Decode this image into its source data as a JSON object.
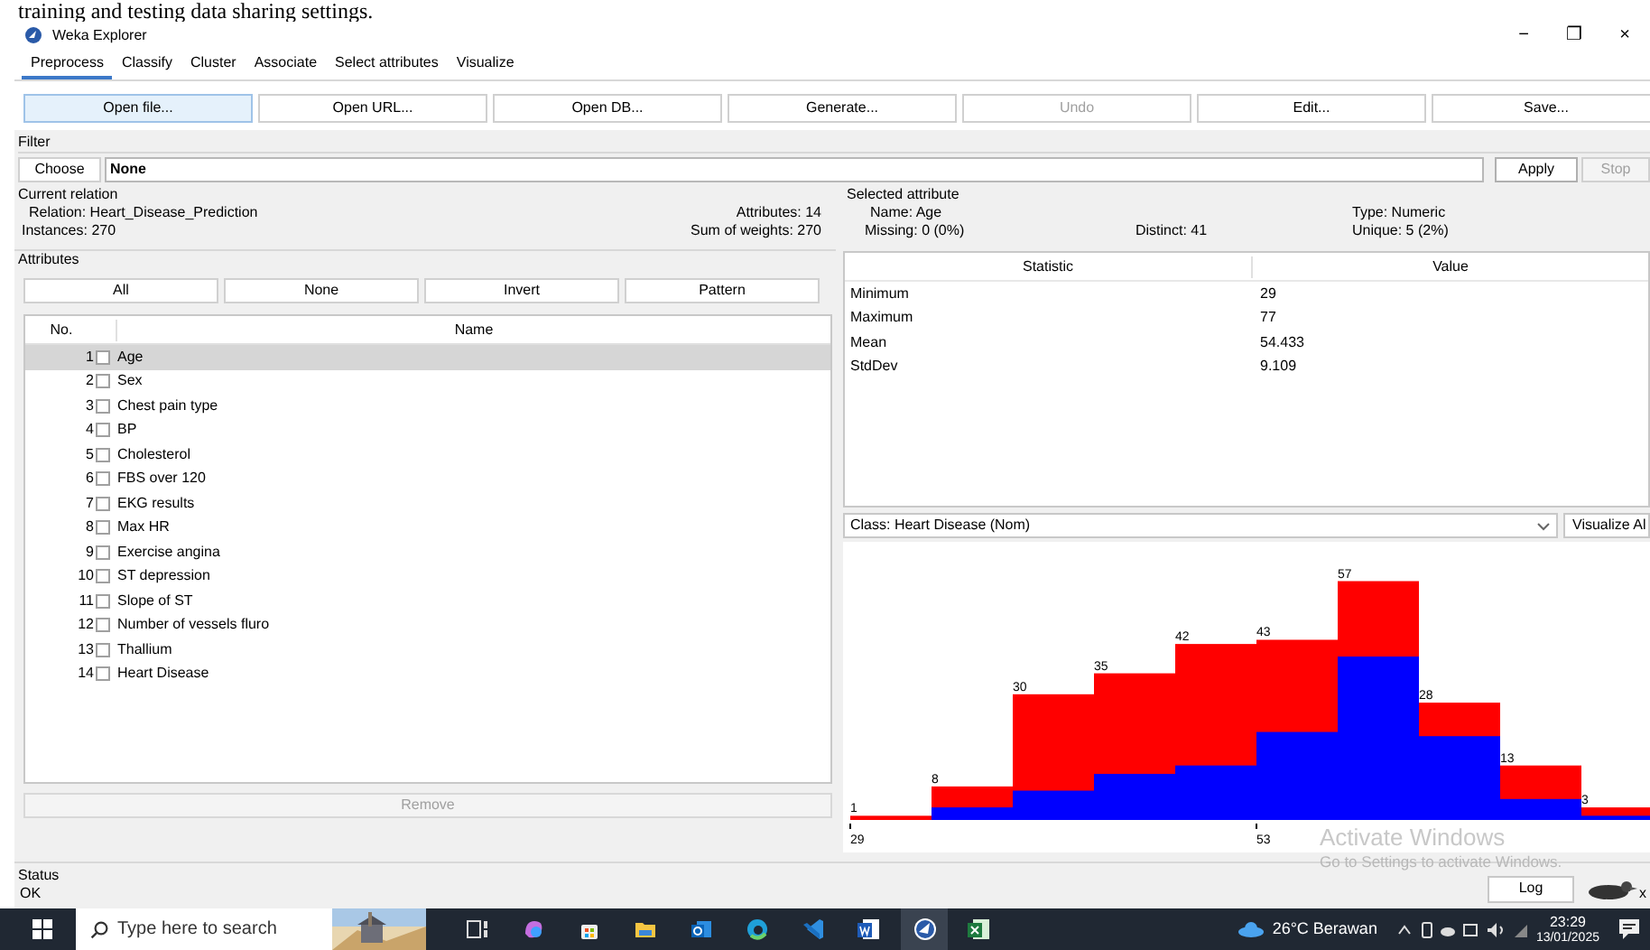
{
  "document_caption": "training and testing data sharing settings.",
  "window": {
    "title": "Weka Explorer",
    "controls": [
      "−",
      "❐",
      "×"
    ]
  },
  "tabs": [
    {
      "label": "Preprocess",
      "selected": true
    },
    {
      "label": "Classify",
      "selected": false
    },
    {
      "label": "Cluster",
      "selected": false
    },
    {
      "label": "Associate",
      "selected": false
    },
    {
      "label": "Select attributes",
      "selected": false
    },
    {
      "label": "Visualize",
      "selected": false
    }
  ],
  "toolbar_buttons": [
    {
      "label": "Open file...",
      "focused": true,
      "disabled": false
    },
    {
      "label": "Open URL...",
      "focused": false,
      "disabled": false
    },
    {
      "label": "Open DB...",
      "focused": false,
      "disabled": false
    },
    {
      "label": "Generate...",
      "focused": false,
      "disabled": false
    },
    {
      "label": "Undo",
      "focused": false,
      "disabled": true
    },
    {
      "label": "Edit...",
      "focused": false,
      "disabled": false
    },
    {
      "label": "Save...",
      "focused": false,
      "disabled": false
    }
  ],
  "filter": {
    "title": "Filter",
    "choose_label": "Choose",
    "value": "None",
    "apply_label": "Apply",
    "stop_label": "Stop",
    "stop_disabled": true
  },
  "current_relation": {
    "title": "Current relation",
    "relation": "Relation: Heart_Disease_Prediction",
    "instances": "Instances: 270",
    "attributes": "Attributes: 14",
    "sum_of_weights": "Sum of weights: 270"
  },
  "attributes": {
    "title": "Attributes",
    "buttons": [
      "All",
      "None",
      "Invert",
      "Pattern"
    ],
    "columns": [
      "No.",
      "Name"
    ],
    "rows": [
      {
        "no": "1",
        "name": "Age",
        "checked": false,
        "selected": true
      },
      {
        "no": "2",
        "name": "Sex",
        "checked": false,
        "selected": false
      },
      {
        "no": "3",
        "name": "Chest pain type",
        "checked": false,
        "selected": false
      },
      {
        "no": "4",
        "name": "BP",
        "checked": false,
        "selected": false
      },
      {
        "no": "5",
        "name": "Cholesterol",
        "checked": false,
        "selected": false
      },
      {
        "no": "6",
        "name": "FBS over 120",
        "checked": false,
        "selected": false
      },
      {
        "no": "7",
        "name": "EKG results",
        "checked": false,
        "selected": false
      },
      {
        "no": "8",
        "name": "Max HR",
        "checked": false,
        "selected": false
      },
      {
        "no": "9",
        "name": "Exercise angina",
        "checked": false,
        "selected": false
      },
      {
        "no": "10",
        "name": "ST depression",
        "checked": false,
        "selected": false
      },
      {
        "no": "11",
        "name": "Slope of ST",
        "checked": false,
        "selected": false
      },
      {
        "no": "12",
        "name": "Number of vessels fluro",
        "checked": false,
        "selected": false
      },
      {
        "no": "13",
        "name": "Thallium",
        "checked": false,
        "selected": false
      },
      {
        "no": "14",
        "name": "Heart Disease",
        "checked": false,
        "selected": false
      }
    ],
    "remove_label": "Remove",
    "remove_disabled": true
  },
  "selected_attribute": {
    "title": "Selected attribute",
    "name": "Name: Age",
    "type": "Type: Numeric",
    "missing": "Missing: 0 (0%)",
    "distinct": "Distinct: 41",
    "unique": "Unique: 5 (2%)",
    "columns": [
      "Statistic",
      "Value"
    ],
    "rows": [
      [
        "Minimum",
        "29"
      ],
      [
        "Maximum",
        "77"
      ],
      [
        "Mean",
        "54.433"
      ],
      [
        "StdDev",
        "9.109"
      ]
    ]
  },
  "class_selector": {
    "value": "Class: Heart Disease (Nom)",
    "visualize_label": "Visualize Al"
  },
  "histogram": {
    "axis_labels": [
      "29",
      "53"
    ],
    "chart_data": {
      "type": "bar",
      "series": [
        {
          "color": "#ff0000",
          "values": [
            1,
            8,
            30,
            35,
            42,
            43,
            57,
            28,
            13,
            3
          ]
        }
      ],
      "data_labels": true
    }
  },
  "activation_notice": {
    "title": "Activate Windows",
    "subtitle": "Go to Settings to activate Windows."
  },
  "status": {
    "title": "Status",
    "message": "OK",
    "log_label": "Log",
    "close_mark": "x"
  },
  "taskbar": {
    "search_placeholder": "Type here to search",
    "weather": "26°C Berawan",
    "time": "23:29",
    "date": "13/01/2025"
  }
}
